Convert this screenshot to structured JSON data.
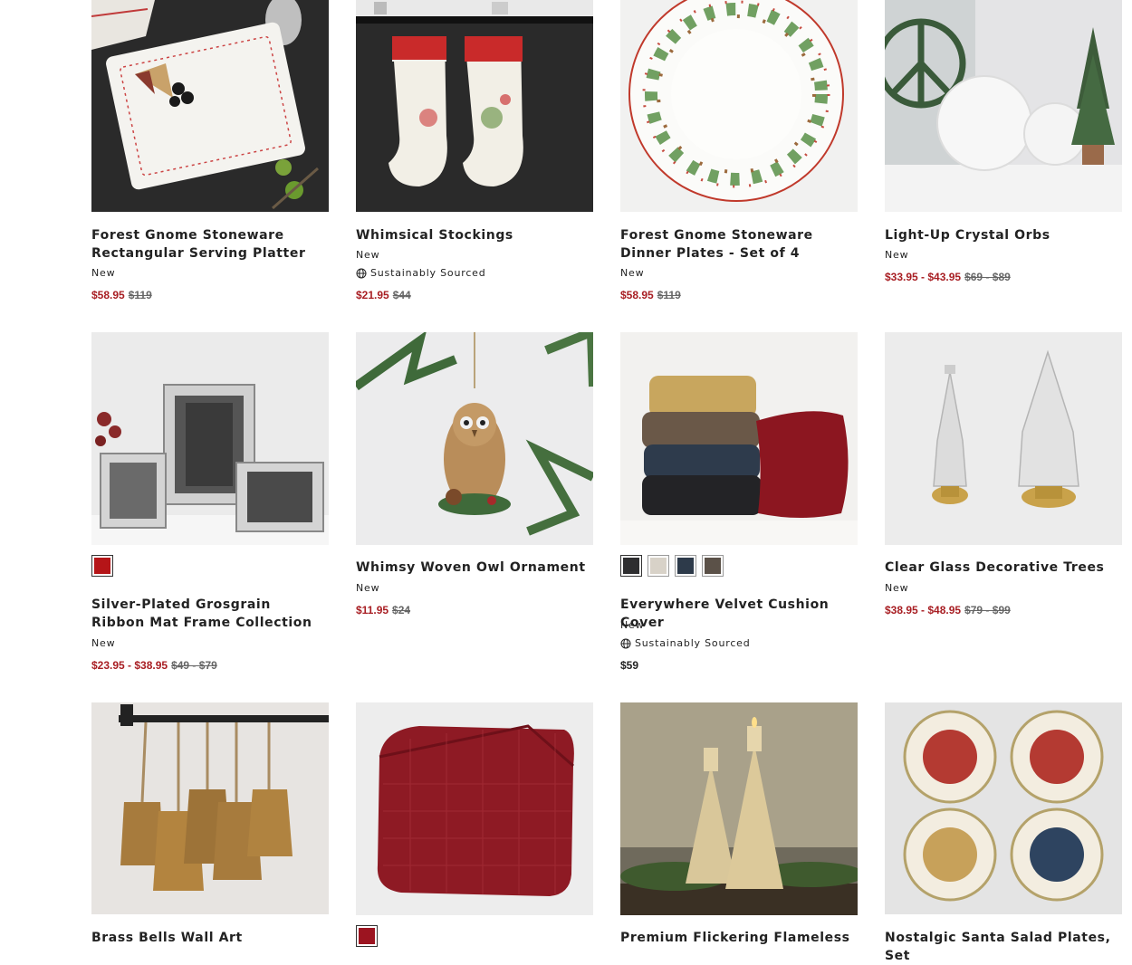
{
  "products": [
    {
      "title": "Forest Gnome Stoneware Rectangular Serving Platter",
      "badge": "New",
      "sale": "$58.95",
      "orig": "$119"
    },
    {
      "title": "Whimsical Stockings",
      "badge": "New",
      "sustain": "Sustainably Sourced",
      "sale": "$21.95",
      "orig": "$44"
    },
    {
      "title": "Forest Gnome Stoneware Dinner Plates - Set of 4",
      "badge": "New",
      "sale": "$58.95",
      "orig": "$119"
    },
    {
      "title": "Light-Up Crystal Orbs",
      "badge": "New",
      "sale": "$33.95 - $43.95",
      "orig": "$69 - $89"
    },
    {
      "title": "Silver-Plated Grosgrain Ribbon Mat Frame Collection",
      "badge": "New",
      "sale": "$23.95 - $38.95",
      "orig": "$49 - $79",
      "swatches": [
        "#b51518"
      ]
    },
    {
      "title": "Whimsy Woven Owl Ornament",
      "badge": "New",
      "sale": "$11.95",
      "orig": "$24"
    },
    {
      "title": "Everywhere Velvet Cushion Cover",
      "badge": "New",
      "sustain": "Sustainably Sourced",
      "regular": "$59",
      "swatches": [
        "#2e2e30",
        "#d8d2c8",
        "#2d3a4a",
        "#5b5148"
      ]
    },
    {
      "title": "Clear Glass Decorative Trees",
      "badge": "New",
      "sale": "$38.95 - $48.95",
      "orig": "$79 - $99"
    },
    {
      "title": "Brass Bells Wall Art"
    },
    {
      "title": "",
      "swatches": [
        "#9c1420"
      ]
    },
    {
      "title": "Premium Flickering Flameless"
    },
    {
      "title": "Nostalgic Santa Salad Plates, Set"
    }
  ],
  "icons": {
    "sustain": "globe-icon"
  },
  "colors": {
    "sale": "#a81e23"
  }
}
